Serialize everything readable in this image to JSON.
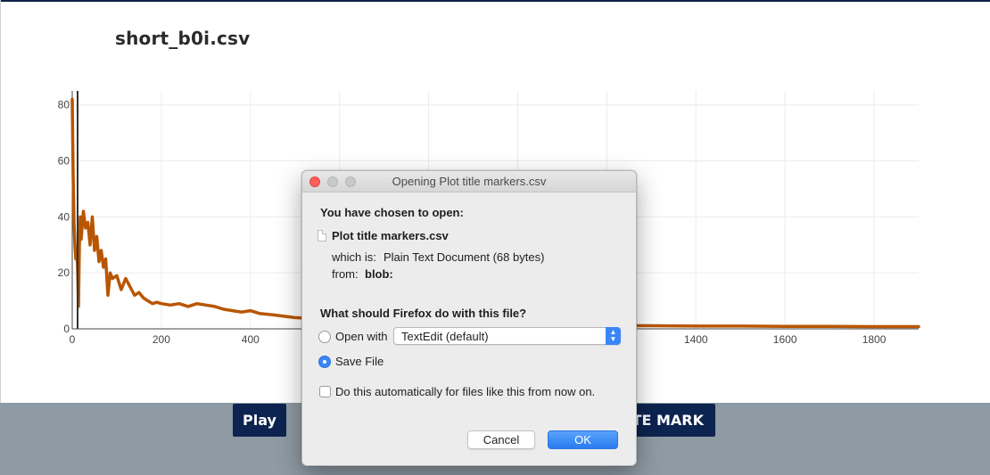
{
  "page": {
    "title": "short_b0i.csv"
  },
  "chart_data": {
    "type": "line",
    "title": "",
    "xlabel": "",
    "ylabel": "",
    "xlim": [
      0,
      1900
    ],
    "ylim": [
      0,
      85
    ],
    "x_ticks": [
      0,
      200,
      400,
      1400,
      1600,
      1800
    ],
    "y_ticks": [
      0,
      20,
      40,
      60,
      80
    ],
    "x_gridlines": [
      0,
      200,
      400,
      600,
      800,
      1000,
      1200,
      1400,
      1600,
      1800
    ],
    "y_gridlines": [
      0,
      20,
      40,
      60,
      80
    ],
    "grid": true,
    "marker_x": 12,
    "series": [
      {
        "color": "#b85600",
        "x": [
          0,
          2,
          4,
          6,
          8,
          10,
          12,
          14,
          16,
          18,
          20,
          25,
          30,
          35,
          40,
          45,
          50,
          55,
          60,
          65,
          70,
          75,
          80,
          85,
          90,
          100,
          110,
          120,
          130,
          140,
          150,
          160,
          170,
          180,
          190,
          200,
          220,
          240,
          260,
          280,
          300,
          320,
          340,
          360,
          380,
          400,
          420,
          450,
          500,
          560,
          600,
          700,
          800,
          900,
          1000,
          1100,
          1200,
          1300,
          1400,
          1500,
          1600,
          1700,
          1800,
          1900
        ],
        "y": [
          82,
          55,
          38,
          30,
          25,
          28,
          22,
          8,
          30,
          40,
          32,
          42,
          36,
          38,
          30,
          40,
          28,
          33,
          24,
          28,
          22,
          25,
          12,
          20,
          18,
          19,
          14,
          18,
          15,
          12,
          13,
          11,
          10,
          9,
          9.5,
          9,
          8.5,
          9,
          8,
          9,
          8.5,
          8,
          7,
          6.5,
          6,
          6.5,
          5.5,
          5,
          4,
          3.5,
          3,
          2.5,
          2,
          1.8,
          1.5,
          1.3,
          1.2,
          1.1,
          1,
          1,
          0.9,
          0.9,
          0.8,
          0.8
        ]
      }
    ]
  },
  "controls": {
    "play_label": "Play",
    "delete_mark_label": "ETE MARK"
  },
  "dialog": {
    "window_title": "Opening Plot title markers.csv",
    "heading": "You have chosen to open:",
    "file_icon": "document-icon",
    "file_name": "Plot title markers.csv",
    "which_is_label": "which is:",
    "which_is_value": "Plain Text Document (68 bytes)",
    "from_label": "from:",
    "from_value": "blob:",
    "question": "What should Firefox do with this file?",
    "open_with_label": "Open with",
    "open_with_selected": "TextEdit (default)",
    "open_with_checked": false,
    "save_file_label": "Save File",
    "save_file_checked": true,
    "auto_label": "Do this automatically for files like this from now on.",
    "auto_checked": false,
    "cancel_label": "Cancel",
    "ok_label": "OK",
    "accent_color": "#3a86f7"
  }
}
